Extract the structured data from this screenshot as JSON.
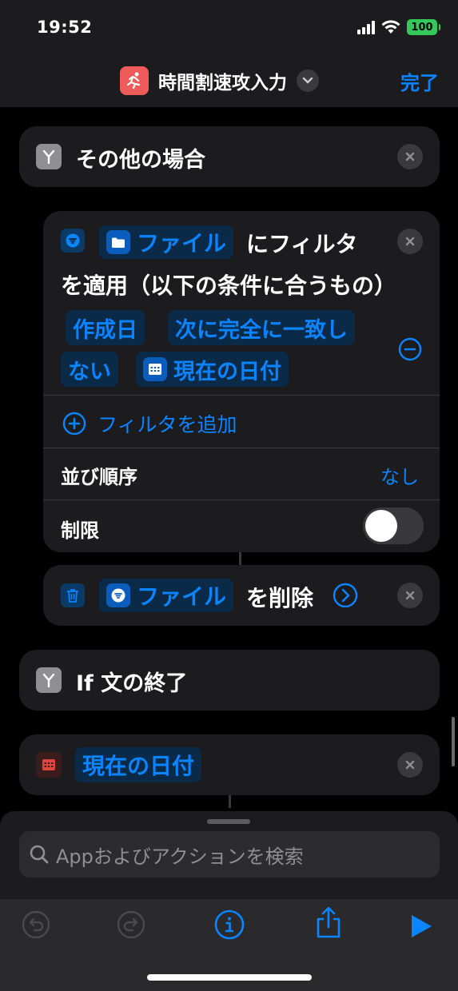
{
  "status": {
    "time": "19:52",
    "battery": "100"
  },
  "nav": {
    "title": "時間割速攻入力",
    "done_label": "完了"
  },
  "otherwise_block": {
    "label": "その他の場合"
  },
  "filter_block": {
    "files_token": "ファイル",
    "text1": "にフィルタ",
    "text2": "を適用（以下の条件に合うもの）",
    "field_token": "作成日",
    "operator_token_line1": "次に完全に一致し",
    "operator_token_line2": "ない",
    "value_token": "現在の日付",
    "add_filter_label": "フィルタを追加",
    "sort_label": "並び順序",
    "sort_value": "なし",
    "limit_label": "制限",
    "limit_enabled": false
  },
  "delete_block": {
    "files_token": "ファイル",
    "text": "を削除"
  },
  "endif_block": {
    "label": "If 文の終了"
  },
  "date_block": {
    "token": "現在の日付"
  },
  "search": {
    "placeholder": "Appおよびアクションを検索"
  },
  "colors": {
    "accent": "#0a84ff",
    "card": "#1c1c1e",
    "app_icon": "#ef5a5a"
  }
}
